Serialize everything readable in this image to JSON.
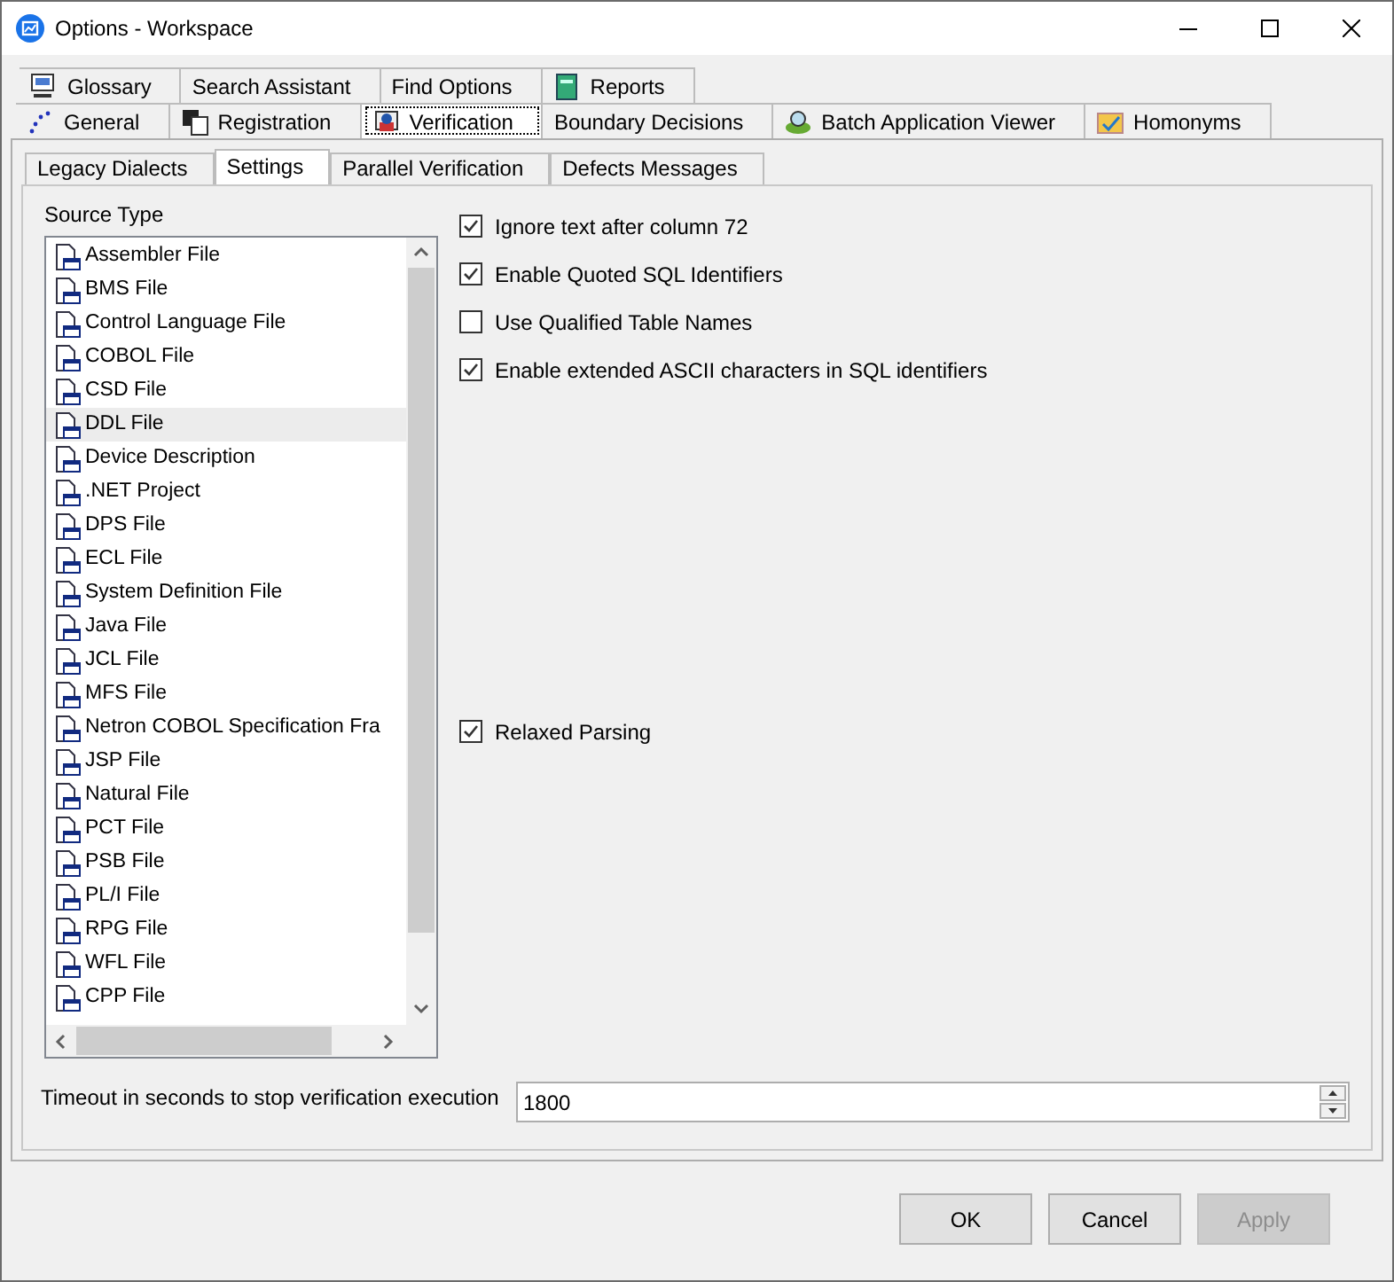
{
  "window": {
    "title": "Options - Workspace"
  },
  "tab_rows": [
    [
      {
        "label": "Glossary",
        "icon": true,
        "selected": false
      },
      {
        "label": "Search Assistant",
        "icon": false,
        "selected": false
      },
      {
        "label": "Find Options",
        "icon": false,
        "selected": false
      },
      {
        "label": "Reports",
        "icon": true,
        "selected": false
      }
    ],
    [
      {
        "label": "General",
        "icon": true,
        "selected": false
      },
      {
        "label": "Registration",
        "icon": true,
        "selected": false
      },
      {
        "label": "Verification",
        "icon": true,
        "selected": true
      },
      {
        "label": "Boundary Decisions",
        "icon": false,
        "selected": false
      },
      {
        "label": "Batch Application Viewer",
        "icon": true,
        "selected": false
      },
      {
        "label": "Homonyms",
        "icon": true,
        "selected": false
      }
    ]
  ],
  "sub_tabs": [
    {
      "label": "Legacy Dialects",
      "selected": false
    },
    {
      "label": "Settings",
      "selected": true
    },
    {
      "label": "Parallel Verification",
      "selected": false
    },
    {
      "label": "Defects Messages",
      "selected": false
    }
  ],
  "source_type": {
    "label": "Source Type",
    "items": [
      {
        "label": "Assembler File",
        "selected": false
      },
      {
        "label": "BMS File",
        "selected": false
      },
      {
        "label": "Control Language File",
        "selected": false
      },
      {
        "label": "COBOL File",
        "selected": false
      },
      {
        "label": "CSD File",
        "selected": false
      },
      {
        "label": "DDL File",
        "selected": true
      },
      {
        "label": "Device Description",
        "selected": false
      },
      {
        "label": ".NET Project",
        "selected": false
      },
      {
        "label": "DPS File",
        "selected": false
      },
      {
        "label": "ECL File",
        "selected": false
      },
      {
        "label": "System Definition File",
        "selected": false
      },
      {
        "label": "Java File",
        "selected": false
      },
      {
        "label": "JCL File",
        "selected": false
      },
      {
        "label": "MFS File",
        "selected": false
      },
      {
        "label": "Netron COBOL Specification Fra",
        "selected": false
      },
      {
        "label": "JSP File",
        "selected": false
      },
      {
        "label": "Natural File",
        "selected": false
      },
      {
        "label": "PCT File",
        "selected": false
      },
      {
        "label": "PSB File",
        "selected": false
      },
      {
        "label": "PL/I File",
        "selected": false
      },
      {
        "label": "RPG File",
        "selected": false
      },
      {
        "label": "WFL File",
        "selected": false
      },
      {
        "label": "CPP File",
        "selected": false
      }
    ]
  },
  "options": [
    {
      "label": "Ignore text after column 72",
      "checked": true
    },
    {
      "label": "Enable Quoted SQL Identifiers",
      "checked": true
    },
    {
      "label": "Use Qualified Table Names",
      "checked": false
    },
    {
      "label": "Enable extended ASCII characters in SQL identifiers",
      "checked": true
    }
  ],
  "relaxed_parsing": {
    "label": "Relaxed Parsing",
    "checked": true
  },
  "timeout": {
    "label": "Timeout in seconds to stop verification execution",
    "value": "1800"
  },
  "buttons": [
    {
      "label": "OK",
      "disabled": false
    },
    {
      "label": "Cancel",
      "disabled": false
    },
    {
      "label": "Apply",
      "disabled": true
    }
  ]
}
